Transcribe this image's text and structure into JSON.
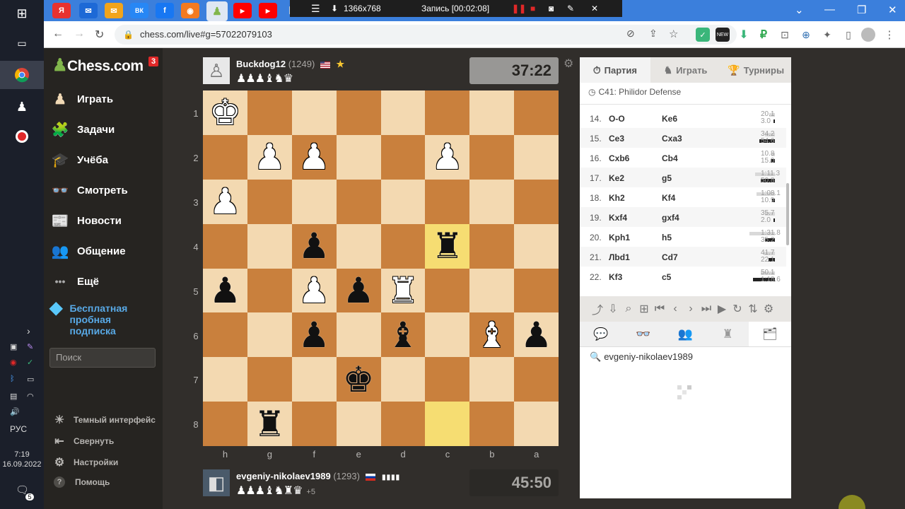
{
  "taskbar": {
    "lang": "РУС",
    "time": "7:19",
    "date": "16.09.2022",
    "notif_count": "5"
  },
  "browser": {
    "url": "chess.com/live#g=57022079103",
    "tabs": [
      "Я",
      "✉",
      "✉",
      "ВК",
      "f",
      "◉",
      "♟",
      "▶",
      "▶",
      "📊"
    ],
    "recorder": {
      "resolution": "1366x768",
      "status": "Запись [00:02:08]"
    }
  },
  "sidebar": {
    "logo": "Chess.com",
    "notif": "3",
    "items": [
      {
        "label": "Играть",
        "icon": "♟"
      },
      {
        "label": "Задачи",
        "icon": "🧩"
      },
      {
        "label": "Учёба",
        "icon": "🎓"
      },
      {
        "label": "Смотреть",
        "icon": "👓"
      },
      {
        "label": "Новости",
        "icon": "📰"
      },
      {
        "label": "Общение",
        "icon": "👥"
      },
      {
        "label": "Ещё",
        "icon": "•••"
      }
    ],
    "premium": "Бесплатная пробная подписка",
    "search_placeholder": "Поиск",
    "bottom": [
      {
        "label": "Темный интерфейс",
        "icon": "☀"
      },
      {
        "label": "Свернуть",
        "icon": "⇤"
      },
      {
        "label": "Настройки",
        "icon": "⚙"
      },
      {
        "label": "Помощь",
        "icon": "?"
      }
    ]
  },
  "top_player": {
    "name": "Buckdog12",
    "rating": "(1249)",
    "flag": "us",
    "captured": "♟♟♟♝♞♛",
    "clock": "37:22"
  },
  "bottom_player": {
    "name": "evgeniy-nikolaev1989",
    "rating": "(1293)",
    "flag": "ru",
    "captured": "♟♟♟♝♞♜♛",
    "advantage": "+5",
    "clock": "45:50"
  },
  "board": {
    "ranks": [
      "1",
      "2",
      "3",
      "4",
      "5",
      "6",
      "7",
      "8"
    ],
    "files": [
      "h",
      "g",
      "f",
      "e",
      "d",
      "c",
      "b",
      "a"
    ],
    "squares": [
      [
        "wK",
        "",
        "",
        "",
        "",
        "",
        "",
        ""
      ],
      [
        "",
        "wP",
        "wP",
        "",
        "",
        "wP",
        "",
        ""
      ],
      [
        "wP",
        "",
        "",
        "",
        "",
        "",
        "",
        ""
      ],
      [
        "",
        "",
        "bP",
        "",
        "",
        "bR",
        "",
        ""
      ],
      [
        "bP",
        "",
        "wP",
        "bP",
        "wR",
        "",
        "",
        ""
      ],
      [
        "",
        "",
        "bP",
        "",
        "bB",
        "",
        "wB",
        "bP"
      ],
      [
        "",
        "",
        "",
        "bK",
        "",
        "",
        "",
        ""
      ],
      [
        "",
        "bR",
        "",
        "",
        "",
        "",
        "",
        ""
      ]
    ],
    "highlights": [
      [
        3,
        5
      ],
      [
        7,
        5
      ]
    ]
  },
  "panel": {
    "tabs": [
      "Партия",
      "Играть",
      "Турниры"
    ],
    "opening": "C41: Philidor Defense",
    "moves": [
      {
        "n": "14.",
        "w": "O-O",
        "b": "Ke6",
        "tw": "20.1",
        "tb": "3.0",
        "bw": 8,
        "bb": 2
      },
      {
        "n": "15.",
        "w": "Ce3",
        "b": "Cxa3",
        "tw": "34.2",
        "tb": "54.6",
        "bw": 14,
        "bb": 22
      },
      {
        "n": "16.",
        "w": "Cxb6",
        "b": "Cb4",
        "tw": "10.8",
        "tb": "15.0",
        "bw": 5,
        "bb": 6
      },
      {
        "n": "17.",
        "w": "Ke2",
        "b": "g5",
        "tw": "1:11.3",
        "tb": "50.8",
        "bw": 28,
        "bb": 20
      },
      {
        "n": "18.",
        "w": "Kh2",
        "b": "Kf4",
        "tw": "1:08.1",
        "tb": "10.9",
        "bw": 26,
        "bb": 4
      },
      {
        "n": "19.",
        "w": "Kxf4",
        "b": "gxf4",
        "tw": "35.7",
        "tb": "2.0",
        "bw": 14,
        "bb": 2
      },
      {
        "n": "20.",
        "w": "Kph1",
        "b": "h5",
        "tw": "1:31.8",
        "tb": "35.2",
        "bw": 36,
        "bb": 14
      },
      {
        "n": "21.",
        "w": "Лbd1",
        "b": "Cd7",
        "tw": "41.7",
        "tb": "22.1",
        "bw": 16,
        "bb": 9
      },
      {
        "n": "22.",
        "w": "Kf3",
        "b": "c5",
        "tw": "50.1",
        "tb": "1:18.6",
        "bw": 20,
        "bb": 31
      }
    ],
    "controls": [
      "share-icon",
      "download-icon",
      "analysis-icon",
      "explorer-icon",
      "first-icon",
      "prev-icon",
      "next-icon",
      "last-icon",
      "play-icon",
      "refresh-icon",
      "flip-icon",
      "settings-icon"
    ],
    "chat_tabs": [
      "chat-icon",
      "watch-icon",
      "friends-icon",
      "stats-icon",
      "games-icon"
    ],
    "search_user": "evgeniy-nikolaev1989"
  }
}
